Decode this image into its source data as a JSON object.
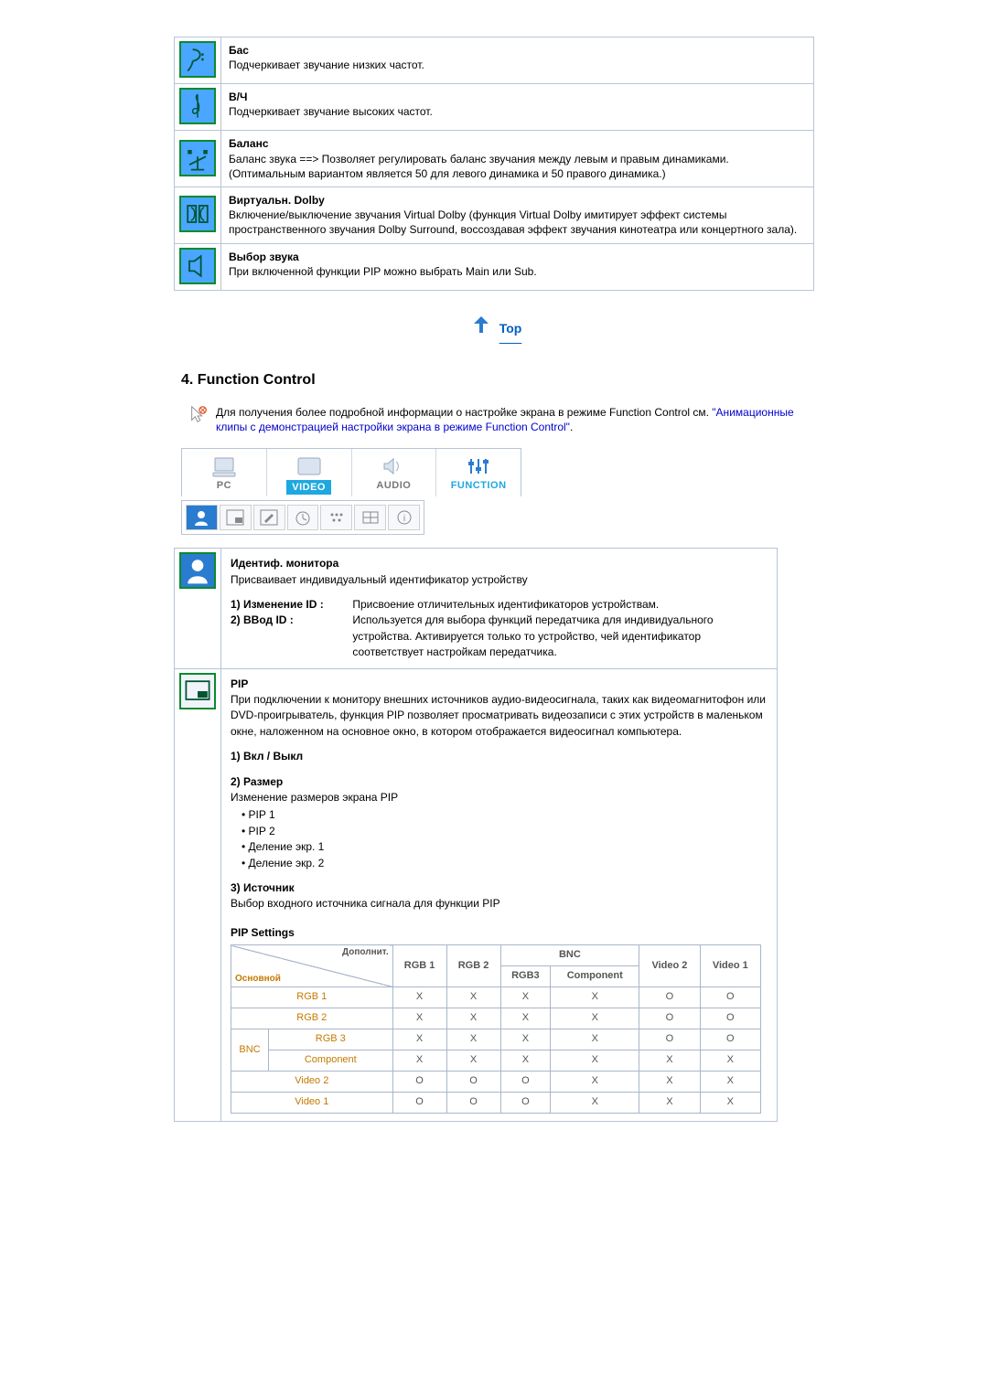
{
  "sound_settings": [
    {
      "id": "bass",
      "title": "Бас",
      "desc": "Подчеркивает звучание низких частот."
    },
    {
      "id": "treble",
      "title": "В/Ч",
      "desc": "Подчеркивает звучание высоких частот."
    },
    {
      "id": "balance",
      "title": "Баланс",
      "desc": "Баланс звука ==> Позволяет регулировать баланс звучания между левым и правым динамиками. (Оптимальным вариантом является 50 для левого динамика и 50 правого динамика.)"
    },
    {
      "id": "dolby",
      "title": "Виртуальн. Dolby",
      "desc": "Включение/выключение звучания Virtual Dolby (функция Virtual Dolby имитирует эффект системы пространственного звучания Dolby Surround, воссоздавая эффект звучания кинотеатра или концертного зала)."
    },
    {
      "id": "soundsel",
      "title": "Выбор звука",
      "desc": "При включенной функции PIP можно выбрать Main или Sub."
    }
  ],
  "top_link_label": "Top",
  "section4_heading": "4. Function Control",
  "info_intro": "Для получения более подробной информации о настройке экрана в режиме Function Control см. ",
  "info_link": "\"Анимационные клипы с демонстрацией настройки экрана в режиме Function Control\"",
  "tabs": {
    "pc": "PC",
    "video": "VIDEO",
    "audio": "AUDIO",
    "function": "FUNCTION"
  },
  "monitor_id": {
    "title": "Идентиф. монитора",
    "desc": "Присваивает индивидуальный идентификатор устройству",
    "row1_label": "1) Изменение ID :",
    "row1_desc": "Присвоение отличительных идентификаторов устройствам.",
    "row2_label": "2) ВВод ID :",
    "row2_desc": "Используется для выбора функций передатчика для индивидуального устройства. Активируется только то устройство, чей идентификатор соответствует настройкам передатчика."
  },
  "pip": {
    "title": "PIP",
    "desc": "При подключении к монитору внешних источников аудио-видеосигнала, таких как видеомагнитофон или DVD-проигрыватель, функция PIP позволяет просматривать видеозаписи с этих устройств в маленьком окне, наложенном на основное окно, в котором отображается видеосигнал компьютера.",
    "item1": "1) Вкл / Выкл",
    "item2": "2) Размер",
    "item2_desc": "Изменение размеров экрана PIP",
    "bullets": [
      "PIP 1",
      "PIP 2",
      "Деление экр. 1",
      "Деление экр. 2"
    ],
    "item3": "3) Источник",
    "item3_desc": "Выбор входного источника сигнала для функции PIP",
    "settings_heading": "PIP Settings",
    "matrix": {
      "diag_top": "Дополнит.",
      "diag_bottom": "Основной",
      "top_headers": [
        "RGB 1",
        "RGB 2",
        "BNC",
        "",
        "Video 2",
        "Video 1"
      ],
      "bnc_sub": [
        "RGB3",
        "Component"
      ],
      "rows": [
        {
          "left_span": "",
          "label": "RGB 1",
          "cells": [
            "X",
            "X",
            "X",
            "X",
            "O",
            "O"
          ]
        },
        {
          "left_span": "",
          "label": "RGB 2",
          "cells": [
            "X",
            "X",
            "X",
            "X",
            "O",
            "O"
          ]
        },
        {
          "left_span": "BNC",
          "label": "RGB 3",
          "cells": [
            "X",
            "X",
            "X",
            "X",
            "O",
            "O"
          ]
        },
        {
          "left_span": "",
          "label": "Component",
          "cells": [
            "X",
            "X",
            "X",
            "X",
            "X",
            "X"
          ]
        },
        {
          "left_span": "",
          "label": "Video 2",
          "cells": [
            "O",
            "O",
            "O",
            "X",
            "X",
            "X"
          ]
        },
        {
          "left_span": "",
          "label": "Video 1",
          "cells": [
            "O",
            "O",
            "O",
            "X",
            "X",
            "X"
          ]
        }
      ]
    }
  }
}
